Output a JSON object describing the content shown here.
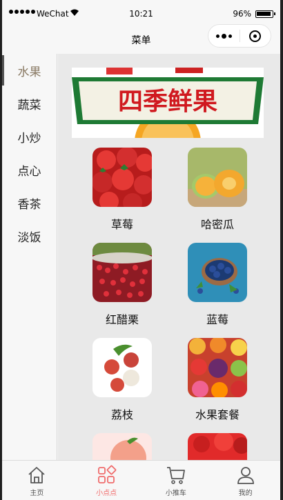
{
  "status": {
    "carrier": "WeChat",
    "time": "10:21",
    "battery": "96%"
  },
  "navbar": {
    "title": "菜单"
  },
  "sidebar": {
    "active_index": 0,
    "items": [
      "水果",
      "蔬菜",
      "小炒",
      "点心",
      "香茶",
      "淡饭"
    ]
  },
  "banner": {
    "text": "四季鲜果"
  },
  "products": [
    {
      "name": "草莓",
      "image": "strawberry"
    },
    {
      "name": "哈密瓜",
      "image": "melon"
    },
    {
      "name": "红醋栗",
      "image": "redcurrant"
    },
    {
      "name": "蓝莓",
      "image": "blueberry"
    },
    {
      "name": "荔枝",
      "image": "lychee"
    },
    {
      "name": "水果套餐",
      "image": "fruit-mix"
    },
    {
      "name": "",
      "image": "peach"
    },
    {
      "name": "",
      "image": "red-fruit"
    }
  ],
  "tabbar": {
    "active_index": 1,
    "active_color": "#f06b6b",
    "items": [
      {
        "label": "主页",
        "icon": "home-icon"
      },
      {
        "label": "小点点",
        "icon": "grid-icon"
      },
      {
        "label": "小推车",
        "icon": "cart-icon"
      },
      {
        "label": "我的",
        "icon": "user-icon"
      }
    ]
  }
}
